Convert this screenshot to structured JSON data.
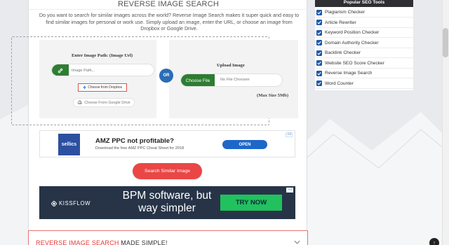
{
  "page": {
    "title": "REVERSE IMAGE SEARCH",
    "description": "Do you want to search for similar images across the world? Reverse Image Search makes it super quick and easy to find similar images for personal or work use. Simply upload an image, enter the URL, or choose an image from Dropbox or Google Drive."
  },
  "upload": {
    "path_label": "Enter Image Path: (Image Url)",
    "path_placeholder": "Image Path...",
    "dropbox_label": "Choose from Dropbox",
    "gdrive_label": "Choose From Google Drive",
    "or_label": "OR",
    "upload_label": "Upload Image",
    "choose_file_label": "Choose File",
    "no_file_label": "No File Choosen",
    "max_size": "(Max Size 5Mb)"
  },
  "ad1": {
    "badge": "Ad",
    "logo_text": "sellics",
    "headline": "AMZ PPC not profitable?",
    "subtext": "Download the free AMZ PPC Cheat Sheet for 2018",
    "cta": "OPEN"
  },
  "search_button": "Search Similar Image",
  "ad2": {
    "badge": "Ad",
    "logo_text": "KISSFLOW",
    "line1": "BPM software, but",
    "line2": "way simpler",
    "cta": "TRY NOW"
  },
  "made_simple": {
    "title_red": "REVERSE IMAGE SEARCH",
    "title_dark": " MADE SIMPLE!"
  },
  "sidebar": {
    "title": "Popular SEO Tools",
    "items": [
      {
        "label": "Plagiarism Checker",
        "icon": "check-square-icon"
      },
      {
        "label": "Article Rewriter",
        "icon": "check-square-icon"
      },
      {
        "label": "Keyword Position Checker",
        "icon": "check-square-icon"
      },
      {
        "label": "Domain Authority Checker",
        "icon": "check-square-icon"
      },
      {
        "label": "Backlink Checker",
        "icon": "check-square-icon"
      },
      {
        "label": "Website SEO Score Checker",
        "icon": "check-square-icon"
      },
      {
        "label": "Reverse Image Search",
        "icon": "check-square-icon"
      },
      {
        "label": "Word Counter",
        "icon": "check-square-icon"
      }
    ]
  },
  "back_to_top_symbol": "↑",
  "colors": {
    "green": "#2e7d32",
    "red": "#ea4646",
    "blue": "#2a6db6",
    "sidebar_header": "#2f2f33"
  }
}
